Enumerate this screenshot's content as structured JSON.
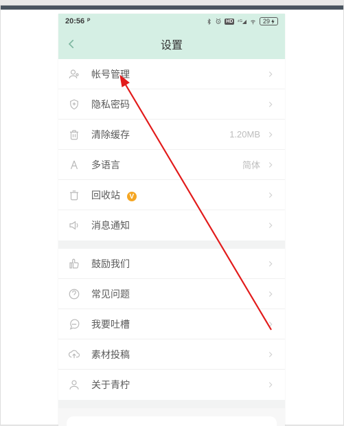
{
  "statusbar": {
    "time": "20:56",
    "battery": "29"
  },
  "header": {
    "title": "设置"
  },
  "groups": [
    [
      {
        "key": "account",
        "label": "帐号管理"
      },
      {
        "key": "privacy",
        "label": "隐私密码"
      },
      {
        "key": "cache",
        "label": "清除缓存",
        "value": "1.20MB"
      },
      {
        "key": "lang",
        "label": "多语言",
        "value": "简体"
      },
      {
        "key": "recycle",
        "label": "回收站",
        "badge": "V"
      },
      {
        "key": "notify",
        "label": "消息通知"
      }
    ],
    [
      {
        "key": "encourage",
        "label": "鼓励我们"
      },
      {
        "key": "faq",
        "label": "常见问题"
      },
      {
        "key": "feedback",
        "label": "我要吐槽"
      },
      {
        "key": "submit",
        "label": "素材投稿"
      },
      {
        "key": "about",
        "label": "关于青柠"
      }
    ]
  ]
}
